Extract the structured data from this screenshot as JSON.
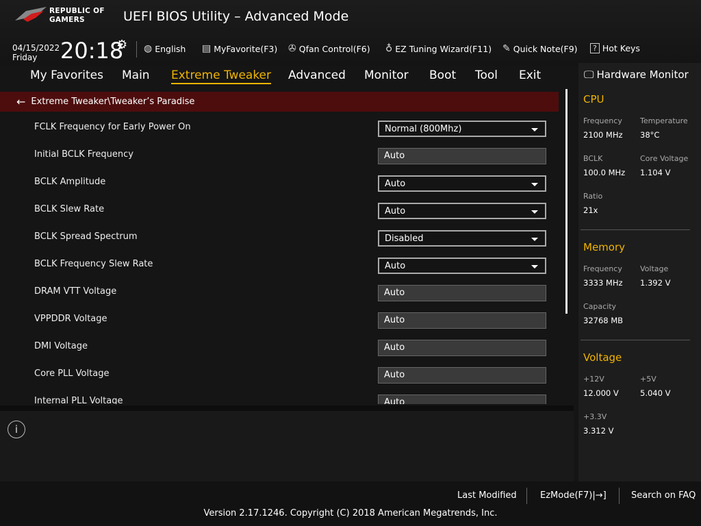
{
  "header": {
    "logo_text": "REPUBLIC OF GAMERS",
    "title": "UEFI BIOS Utility – Advanced Mode",
    "date": "04/15/2022",
    "day": "Friday",
    "time": "20:18"
  },
  "toolbar": [
    {
      "label": "English",
      "icon": "globe-icon"
    },
    {
      "label": "MyFavorite(F3)",
      "icon": "favorite-icon"
    },
    {
      "label": "Qfan Control(F6)",
      "icon": "fan-icon"
    },
    {
      "label": "EZ Tuning Wizard(F11)",
      "icon": "lightbulb-icon"
    },
    {
      "label": "Quick Note(F9)",
      "icon": "note-icon"
    },
    {
      "label": "Hot Keys",
      "icon": "help-icon"
    }
  ],
  "tabs": [
    "My Favorites",
    "Main",
    "Extreme Tweaker",
    "Advanced",
    "Monitor",
    "Boot",
    "Tool",
    "Exit"
  ],
  "active_tab": "Extreme Tweaker",
  "breadcrumb": "Extreme Tweaker\\Tweaker’s Paradise",
  "settings": [
    {
      "label": "FCLK Frequency for Early Power On",
      "value": "Normal (800Mhz)",
      "type": "dropdown"
    },
    {
      "label": "Initial BCLK Frequency",
      "value": "Auto",
      "type": "text"
    },
    {
      "label": "BCLK Amplitude",
      "value": "Auto",
      "type": "dropdown"
    },
    {
      "label": "BCLK Slew Rate",
      "value": "Auto",
      "type": "dropdown"
    },
    {
      "label": "BCLK Spread Spectrum",
      "value": "Disabled",
      "type": "dropdown"
    },
    {
      "label": "BCLK Frequency Slew Rate",
      "value": "Auto",
      "type": "dropdown"
    },
    {
      "label": "DRAM VTT Voltage",
      "value": "Auto",
      "type": "text"
    },
    {
      "label": "VPPDDR Voltage",
      "value": "Auto",
      "type": "text"
    },
    {
      "label": "DMI Voltage",
      "value": "Auto",
      "type": "text"
    },
    {
      "label": "Core PLL Voltage",
      "value": "Auto",
      "type": "text"
    },
    {
      "label": "Internal PLL Voltage",
      "value": "Auto",
      "type": "text"
    }
  ],
  "hw": {
    "title": "Hardware Monitor",
    "cpu": {
      "title": "CPU",
      "freq_k": "Frequency",
      "freq_v": "2100 MHz",
      "temp_k": "Temperature",
      "temp_v": "38°C",
      "bclk_k": "BCLK",
      "bclk_v": "100.0 MHz",
      "cv_k": "Core Voltage",
      "cv_v": "1.104 V",
      "ratio_k": "Ratio",
      "ratio_v": "21x"
    },
    "mem": {
      "title": "Memory",
      "freq_k": "Frequency",
      "freq_v": "3333 MHz",
      "volt_k": "Voltage",
      "volt_v": "1.392 V",
      "cap_k": "Capacity",
      "cap_v": "32768 MB"
    },
    "volt": {
      "title": "Voltage",
      "v12_k": "+12V",
      "v12_v": "12.000 V",
      "v5_k": "+5V",
      "v5_v": "5.040 V",
      "v33_k": "+3.3V",
      "v33_v": "3.312 V"
    }
  },
  "footer": {
    "last_modified": "Last Modified",
    "ezmode": "EzMode(F7)|→]",
    "faq": "Search on FAQ",
    "version": "Version 2.17.1246. Copyright (C) 2018 American Megatrends, Inc."
  },
  "colors": {
    "accent": "#f0b400",
    "breadcrumb_bg": "#4e0d0d"
  }
}
